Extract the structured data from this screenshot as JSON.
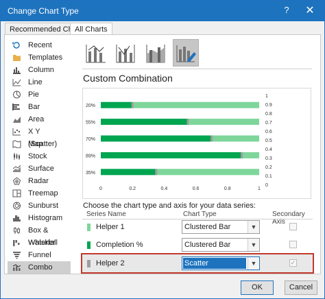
{
  "window": {
    "title": "Change Chart Type",
    "help": "?",
    "close": "✕"
  },
  "tabs": [
    {
      "label": "Recommended Charts"
    },
    {
      "label": "All Charts"
    }
  ],
  "sidebar": {
    "items": [
      {
        "label": "Recent",
        "icon": "recent-icon"
      },
      {
        "label": "Templates",
        "icon": "folder-icon"
      },
      {
        "label": "Column",
        "icon": "column-chart-icon"
      },
      {
        "label": "Line",
        "icon": "line-chart-icon"
      },
      {
        "label": "Pie",
        "icon": "pie-chart-icon"
      },
      {
        "label": "Bar",
        "icon": "bar-chart-icon"
      },
      {
        "label": "Area",
        "icon": "area-chart-icon"
      },
      {
        "label": "X Y (Scatter)",
        "icon": "scatter-chart-icon"
      },
      {
        "label": "Map",
        "icon": "map-chart-icon"
      },
      {
        "label": "Stock",
        "icon": "stock-chart-icon"
      },
      {
        "label": "Surface",
        "icon": "surface-chart-icon"
      },
      {
        "label": "Radar",
        "icon": "radar-chart-icon"
      },
      {
        "label": "Treemap",
        "icon": "treemap-chart-icon"
      },
      {
        "label": "Sunburst",
        "icon": "sunburst-chart-icon"
      },
      {
        "label": "Histogram",
        "icon": "histogram-chart-icon"
      },
      {
        "label": "Box & Whisker",
        "icon": "box-whisker-chart-icon"
      },
      {
        "label": "Waterfall",
        "icon": "waterfall-chart-icon"
      },
      {
        "label": "Funnel",
        "icon": "funnel-chart-icon"
      },
      {
        "label": "Combo",
        "icon": "combo-chart-icon"
      }
    ],
    "selected": "Combo"
  },
  "combo_types": [
    {
      "icon": "clustered-column-line-icon"
    },
    {
      "icon": "clustered-column-line-secondary-icon"
    },
    {
      "icon": "stacked-area-clustered-column-icon"
    },
    {
      "icon": "custom-combination-icon"
    }
  ],
  "preview": {
    "heading": "Custom Combination"
  },
  "chart_data": {
    "type": "bar",
    "categories": [
      "20%",
      "55%",
      "70%",
      "89%",
      "35%"
    ],
    "series": [
      {
        "name": "Completion %",
        "values": [
          0.2,
          0.55,
          0.7,
          0.89,
          0.35
        ],
        "color": "#00a550"
      },
      {
        "name": "Helper 1",
        "values": [
          0.8,
          0.45,
          0.3,
          0.11,
          0.65
        ],
        "color": "#7ed69a"
      }
    ],
    "x_ticks": [
      "0",
      "0.2",
      "0.4",
      "0.6",
      "0.8",
      "1"
    ],
    "secondary_ticks": [
      "1",
      "0.9",
      "0.8",
      "0.7",
      "0.6",
      "0.5",
      "0.4",
      "0.3",
      "0.2",
      "0.1",
      "0"
    ],
    "xlim": [
      0,
      1
    ],
    "stacked": true
  },
  "instruction": "Choose the chart type and axis for your data series:",
  "table": {
    "headers": {
      "name": "Series Name",
      "type": "Chart Type",
      "axis": "Secondary Axis"
    },
    "rows": [
      {
        "name": "Helper 1",
        "type": "Clustered Bar",
        "color": "#7ed69a",
        "secondary": false
      },
      {
        "name": "Completion %",
        "type": "Clustered Bar",
        "color": "#00a550",
        "secondary": false
      },
      {
        "name": "Helper 2",
        "type": "Scatter",
        "color": "#9e9e9e",
        "secondary": true
      }
    ]
  },
  "footer": {
    "ok": "OK",
    "cancel": "Cancel"
  }
}
